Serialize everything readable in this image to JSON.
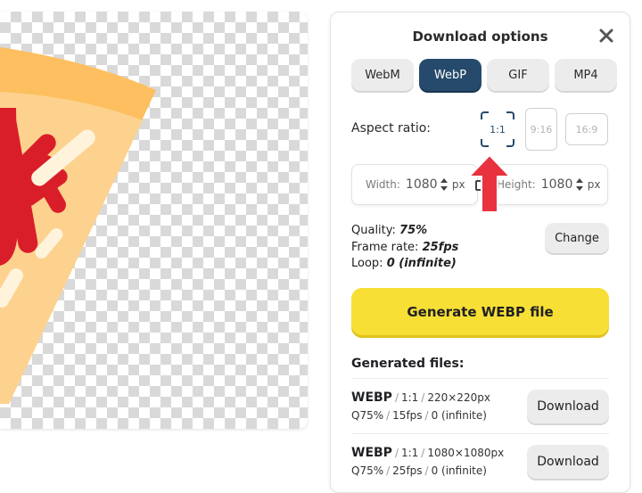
{
  "panel": {
    "title": "Download options",
    "formats": [
      {
        "label": "WebM",
        "active": false
      },
      {
        "label": "WebP",
        "active": true
      },
      {
        "label": "GIF",
        "active": false
      },
      {
        "label": "MP4",
        "active": false
      }
    ],
    "aspect_label": "Aspect ratio:",
    "ratios": [
      "1:1",
      "9:16",
      "16:9"
    ],
    "width_label": "Width:",
    "width_value": "1080",
    "height_label": "Height:",
    "height_value": "1080",
    "unit": "px",
    "quality_label": "Quality:",
    "quality_value": "75%",
    "framerate_label": "Frame rate:",
    "framerate_value": "25fps",
    "loop_label": "Loop:",
    "loop_value": "0 (infinite)",
    "change_label": "Change",
    "generate_label": "Generate WEBP file",
    "generated_title": "Generated files:",
    "files": [
      {
        "format": "WEBP",
        "ratio": "1:1",
        "size": "220×220px",
        "quality": "Q75%",
        "fps": "15fps",
        "loop": "0 (infinite)",
        "button": "Download"
      },
      {
        "format": "WEBP",
        "ratio": "1:1",
        "size": "1080×1080px",
        "quality": "Q75%",
        "fps": "25fps",
        "loop": "0 (infinite)",
        "button": "Download"
      }
    ]
  },
  "colors": {
    "accent": "#264a6b",
    "generate": "#f8df35",
    "arrow": "#e8333f",
    "pizza_crust": "#fdbf5f",
    "pizza_cheese": "#fdd28e",
    "sauce": "#d91e2a"
  },
  "icons": [
    "close-icon",
    "lock-icon",
    "up-arrow-icon"
  ]
}
